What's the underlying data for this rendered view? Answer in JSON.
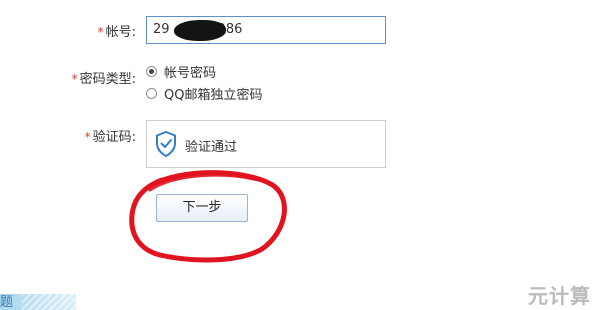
{
  "form": {
    "account": {
      "required_mark": "*",
      "label": "帐号:",
      "value_prefix": "29",
      "value_suffix": "986"
    },
    "password_type": {
      "required_mark": "*",
      "label": "密码类型:",
      "options": [
        {
          "label": "帐号密码",
          "selected": true
        },
        {
          "label": "QQ邮箱独立密码",
          "selected": false
        }
      ]
    },
    "captcha": {
      "required_mark": "*",
      "label": "验证码:",
      "icon": "shield-check-icon",
      "status_text": "验证通过"
    },
    "next_button_label": "下一步"
  },
  "footer": {
    "tab_fragment": "题",
    "watermark": "元计算"
  },
  "colors": {
    "required_mark": "#e63a2e",
    "input_border_focus": "#5f8fcf",
    "shield_blue": "#2f7fd0",
    "annotation_red": "#e0131e"
  }
}
